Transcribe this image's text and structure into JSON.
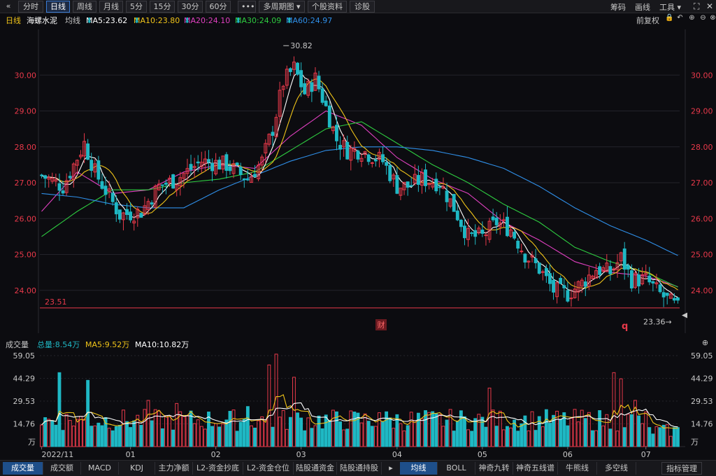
{
  "toolbar": {
    "collapse_icon": "double-chevron-left-icon",
    "tabs": [
      "分时",
      "日线",
      "周线",
      "月线",
      "5分",
      "15分",
      "30分",
      "60分"
    ],
    "active_tab": "日线",
    "more_icon": "ellipsis-icon",
    "multi_period": "多周期图",
    "stock_info": "个股资料",
    "diagnosis": "诊股",
    "right_items": [
      "筹码",
      "画线",
      "工具"
    ]
  },
  "ma_bar": {
    "period": "日线",
    "stock_name": "海螺水泥",
    "indicator": "均线",
    "ma5": "MA5:23.62",
    "ma10": "MA10:23.80",
    "ma20": "MA20:24.10",
    "ma30": "MA30:24.09",
    "ma60": "MA60:24.97",
    "adjust": "前复权"
  },
  "colors": {
    "up": "#e8394a",
    "down": "#1fb8c4",
    "ma5": "#ffffff",
    "ma10": "#f0c419",
    "ma20": "#e040c0",
    "ma30": "#2ecc40",
    "ma60": "#2f8fe8",
    "accent": "#3a7bd5"
  },
  "chart_data": [
    {
      "type": "candlestick",
      "title": "海螺水泥 日线",
      "y_ticks": [
        "30.00",
        "29.00",
        "28.00",
        "27.00",
        "26.00",
        "25.00",
        "24.00"
      ],
      "ylim": [
        23.0,
        31.0
      ],
      "high_marker": "30.82",
      "low_marker": "23.36",
      "reference_line": "23.51",
      "fin_marker": "财",
      "q_marker": "q",
      "anchors": [
        [
          0,
          27.2
        ],
        [
          6,
          26.9
        ],
        [
          12,
          28.1
        ],
        [
          15,
          27.3
        ],
        [
          22,
          26.1
        ],
        [
          28,
          26.2
        ],
        [
          33,
          26.9
        ],
        [
          38,
          27.1
        ],
        [
          45,
          27.6
        ],
        [
          52,
          27.5
        ],
        [
          58,
          27.1
        ],
        [
          62,
          27.6
        ],
        [
          65,
          28.5
        ],
        [
          68,
          29.8
        ],
        [
          71,
          30.2
        ],
        [
          74,
          29.5
        ],
        [
          77,
          29.9
        ],
        [
          80,
          29.1
        ],
        [
          83,
          28.2
        ],
        [
          86,
          27.9
        ],
        [
          90,
          27.9
        ],
        [
          96,
          27.6
        ],
        [
          100,
          26.9
        ],
        [
          103,
          26.9
        ],
        [
          107,
          27.1
        ],
        [
          112,
          27.0
        ],
        [
          116,
          26.3
        ],
        [
          120,
          25.5
        ],
        [
          124,
          25.5
        ],
        [
          128,
          25.9
        ],
        [
          132,
          25.7
        ],
        [
          136,
          25.0
        ],
        [
          140,
          24.6
        ],
        [
          144,
          24.0
        ],
        [
          148,
          23.9
        ],
        [
          152,
          24.2
        ],
        [
          156,
          24.6
        ],
        [
          160,
          24.5
        ],
        [
          163,
          24.9
        ],
        [
          166,
          24.3
        ],
        [
          170,
          24.3
        ],
        [
          174,
          23.9
        ],
        [
          179,
          23.5
        ]
      ],
      "ma_series": [
        {
          "name": "MA20",
          "points": [
            [
              0,
              26.2
            ],
            [
              10,
              27.3
            ],
            [
              20,
              26.7
            ],
            [
              30,
              26.8
            ],
            [
              40,
              27.3
            ],
            [
              50,
              27.5
            ],
            [
              60,
              27.4
            ],
            [
              70,
              28.3
            ],
            [
              80,
              29.0
            ],
            [
              90,
              28.6
            ],
            [
              100,
              27.7
            ],
            [
              110,
              27.1
            ],
            [
              120,
              26.7
            ],
            [
              130,
              25.9
            ],
            [
              140,
              25.4
            ],
            [
              150,
              24.8
            ],
            [
              160,
              24.5
            ],
            [
              170,
              24.4
            ],
            [
              179,
              24.1
            ]
          ]
        },
        {
          "name": "MA30",
          "points": [
            [
              0,
              25.5
            ],
            [
              10,
              26.2
            ],
            [
              20,
              26.8
            ],
            [
              30,
              26.8
            ],
            [
              40,
              27.0
            ],
            [
              50,
              27.1
            ],
            [
              60,
              27.3
            ],
            [
              70,
              27.9
            ],
            [
              80,
              28.5
            ],
            [
              90,
              28.7
            ],
            [
              100,
              28.1
            ],
            [
              110,
              27.5
            ],
            [
              120,
              27.0
            ],
            [
              130,
              26.4
            ],
            [
              140,
              25.9
            ],
            [
              150,
              25.2
            ],
            [
              160,
              24.8
            ],
            [
              170,
              24.5
            ],
            [
              179,
              24.09
            ]
          ]
        },
        {
          "name": "MA60",
          "points": [
            [
              0,
              26.7
            ],
            [
              10,
              26.6
            ],
            [
              20,
              26.4
            ],
            [
              30,
              26.3
            ],
            [
              40,
              26.3
            ],
            [
              50,
              26.8
            ],
            [
              60,
              27.2
            ],
            [
              70,
              27.6
            ],
            [
              80,
              27.9
            ],
            [
              90,
              28.0
            ],
            [
              100,
              28.0
            ],
            [
              110,
              27.9
            ],
            [
              120,
              27.7
            ],
            [
              130,
              27.4
            ],
            [
              140,
              26.9
            ],
            [
              150,
              26.3
            ],
            [
              160,
              25.8
            ],
            [
              170,
              25.4
            ],
            [
              179,
              24.97
            ]
          ]
        }
      ]
    },
    {
      "type": "bar",
      "title": "成交量",
      "summary": {
        "label": "成交量",
        "total": "总量:8.54万",
        "ma5": "MA5:9.52万",
        "ma10": "MA10:10.82万"
      },
      "unit": "万",
      "y_ticks": [
        "59.05",
        "44.29",
        "29.53",
        "14.76"
      ],
      "ylim": [
        0,
        59.05
      ],
      "x_ticks": [
        "2022/11",
        "01",
        "02",
        "03",
        "04",
        "05",
        "06",
        "07"
      ],
      "spikes": [
        [
          5,
          48
        ],
        [
          13,
          43
        ],
        [
          30,
          30
        ],
        [
          38,
          28
        ],
        [
          58,
          26
        ],
        [
          64,
          53
        ],
        [
          66,
          60
        ],
        [
          71,
          45
        ],
        [
          95,
          22
        ],
        [
          126,
          38
        ],
        [
          161,
          48
        ],
        [
          163,
          44
        ],
        [
          167,
          30
        ]
      ],
      "base": 18
    }
  ],
  "bottom_tabs": [
    "成交量",
    "成交额",
    "MACD",
    "KDJ",
    "主力净额",
    "L2-资金抄底",
    "L2-资金仓位",
    "陆股通资金",
    "陆股通持股",
    "均线",
    "BOLL",
    "神奇九转",
    "神奇五线谱",
    "牛熊线",
    "多空线",
    "指标管理"
  ],
  "active_bottom_tabs": [
    "成交量",
    "均线"
  ]
}
